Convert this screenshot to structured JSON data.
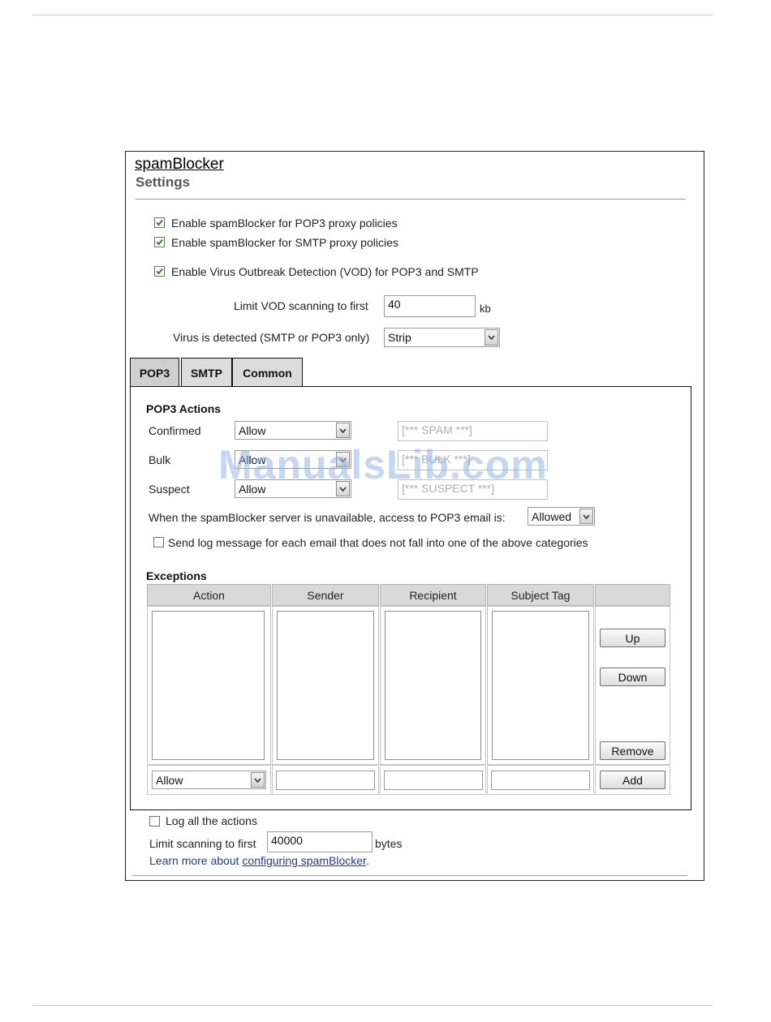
{
  "header": {
    "title": "spamBlocker",
    "subtitle": "Settings"
  },
  "global": {
    "enable_pop3": {
      "label": "Enable spamBlocker for POP3 proxy policies",
      "checked": true
    },
    "enable_smtp": {
      "label": "Enable spamBlocker for SMTP proxy policies",
      "checked": true
    },
    "enable_vod": {
      "label": "Enable Virus Outbreak Detection (VOD) for POP3 and SMTP",
      "checked": true
    },
    "vod_limit": {
      "label": "Limit VOD scanning to first",
      "value": "40",
      "unit": "kb"
    },
    "virus_detected": {
      "label": "Virus is detected (SMTP or POP3 only)",
      "value": "Strip"
    }
  },
  "tabs": [
    {
      "label": "POP3",
      "active": true
    },
    {
      "label": "SMTP",
      "active": false
    },
    {
      "label": "Common",
      "active": false
    }
  ],
  "pop3": {
    "section_title": "POP3 Actions",
    "rows": [
      {
        "label": "Confirmed",
        "action": "Allow",
        "tag": "[*** SPAM ***]"
      },
      {
        "label": "Bulk",
        "action": "Allow",
        "tag": "[*** BULK ***]"
      },
      {
        "label": "Suspect",
        "action": "Allow",
        "tag": "[*** SUSPECT ***]"
      }
    ],
    "unavailable": {
      "label": "When the spamBlocker server is unavailable, access to POP3 email is:",
      "value": "Allowed"
    },
    "send_log": {
      "label": "Send log message for each email that does not fall into one of the above categories",
      "checked": false
    },
    "exceptions": {
      "title": "Exceptions",
      "columns": [
        "Action",
        "Sender",
        "Recipient",
        "Subject Tag"
      ],
      "buttons": {
        "up": "Up",
        "down": "Down",
        "remove": "Remove",
        "add": "Add"
      },
      "new_action": "Allow"
    }
  },
  "footer": {
    "log_all": {
      "label": "Log all the actions",
      "checked": false
    },
    "limit_scanning": {
      "label": "Limit scanning to first",
      "value": "40000",
      "unit": "bytes"
    },
    "learn_more_prefix": "Learn more about ",
    "learn_more_link": "configuring spamBlocker",
    "learn_more_suffix": "."
  },
  "watermark": "ManualsLib.com"
}
